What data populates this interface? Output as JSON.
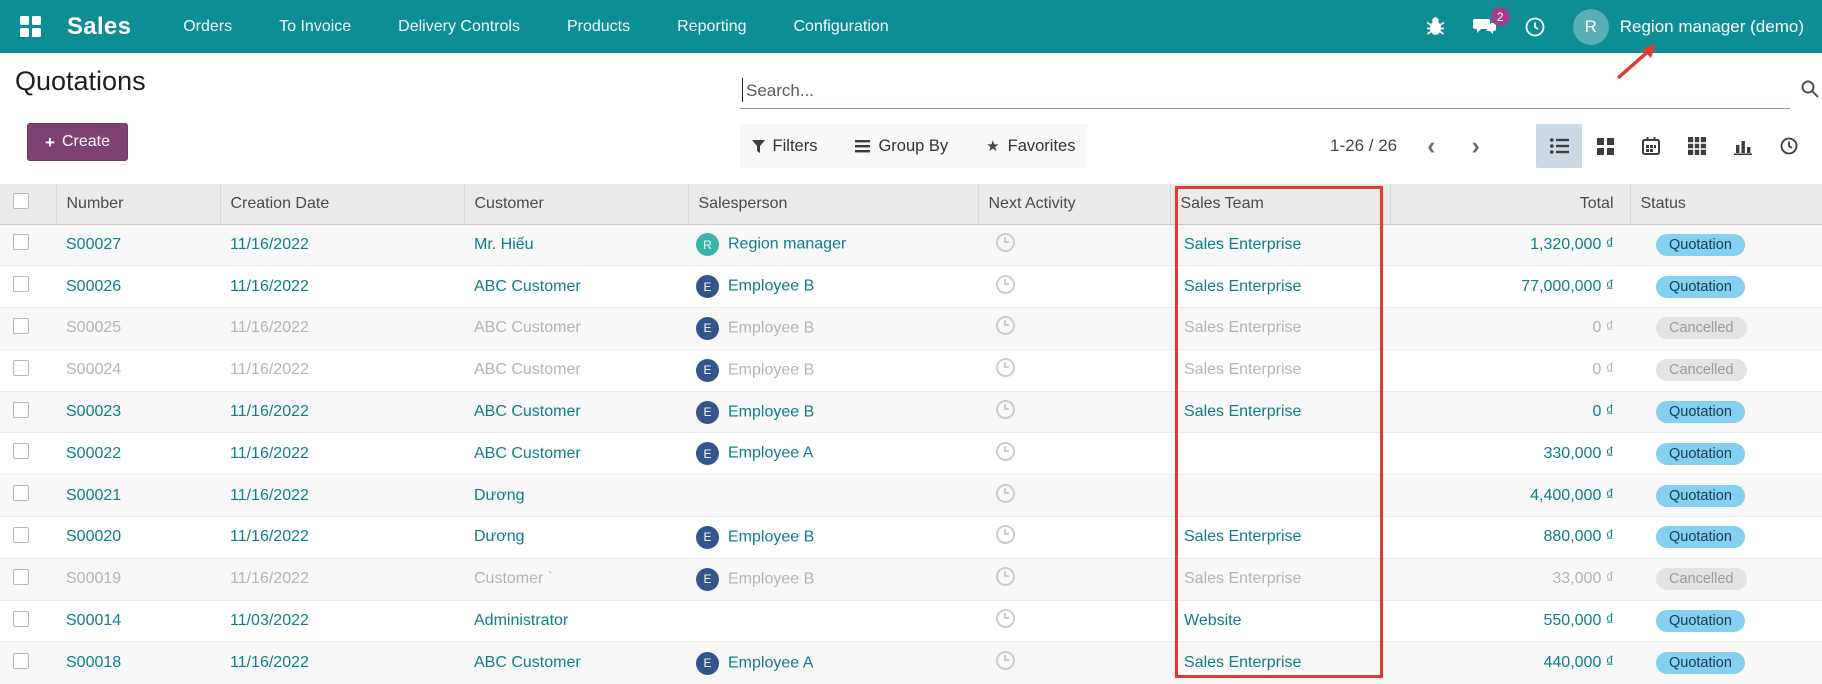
{
  "navbar": {
    "app_name": "Sales",
    "menu": [
      {
        "label": "Orders"
      },
      {
        "label": "To Invoice"
      },
      {
        "label": "Delivery Controls"
      },
      {
        "label": "Products"
      },
      {
        "label": "Reporting"
      },
      {
        "label": "Configuration"
      }
    ],
    "message_count": "2",
    "user": {
      "initial": "R",
      "name": "Region manager (demo)"
    },
    "icons": [
      "apps-grid-icon",
      "bug-icon",
      "messages-icon",
      "activity-clock-icon",
      "user-avatar"
    ]
  },
  "page": {
    "title": "Quotations",
    "create_label": "Create",
    "create_plus_glyph": "+"
  },
  "search": {
    "placeholder": "Search...",
    "filters_label": "Filters",
    "group_by_label": "Group By",
    "favorites_label": "Favorites",
    "favorites_star_glyph": "★"
  },
  "pager": {
    "range": "1-26 / 26",
    "prev_glyph": "‹",
    "next_glyph": "›"
  },
  "view_switcher": {
    "views": [
      "list-view",
      "kanban-view",
      "calendar-view",
      "pivot-view",
      "graph-view",
      "activity-view"
    ],
    "active": "list-view"
  },
  "table": {
    "columns": {
      "number": "Number",
      "creation_date": "Creation Date",
      "customer": "Customer",
      "salesperson": "Salesperson",
      "next_activity": "Next Activity",
      "sales_team": "Sales Team",
      "total": "Total",
      "status": "Status"
    },
    "rows": [
      {
        "number": "S00027",
        "date": "11/16/2022",
        "customer": "Mr. Hiếu",
        "salesperson_initial": "R",
        "salesperson": "Region manager",
        "avatar_color": "#36b5a8",
        "team": "Sales Enterprise",
        "total": "1,320,000 ₫",
        "status": "Quotation"
      },
      {
        "number": "S00026",
        "date": "11/16/2022",
        "customer": "ABC Customer",
        "salesperson_initial": "E",
        "salesperson": "Employee B",
        "avatar_color": "#34558b",
        "team": "Sales Enterprise",
        "total": "77,000,000 ₫",
        "status": "Quotation"
      },
      {
        "number": "S00025",
        "date": "11/16/2022",
        "customer": "ABC Customer",
        "salesperson_initial": "E",
        "salesperson": "Employee B",
        "avatar_color": "#34558b",
        "team": "Sales Enterprise",
        "total": "0 ₫",
        "status": "Cancelled"
      },
      {
        "number": "S00024",
        "date": "11/16/2022",
        "customer": "ABC Customer",
        "salesperson_initial": "E",
        "salesperson": "Employee B",
        "avatar_color": "#34558b",
        "team": "Sales Enterprise",
        "total": "0 ₫",
        "status": "Cancelled"
      },
      {
        "number": "S00023",
        "date": "11/16/2022",
        "customer": "ABC Customer",
        "salesperson_initial": "E",
        "salesperson": "Employee B",
        "avatar_color": "#34558b",
        "team": "Sales Enterprise",
        "total": "0 ₫",
        "status": "Quotation"
      },
      {
        "number": "S00022",
        "date": "11/16/2022",
        "customer": "ABC Customer",
        "salesperson_initial": "E",
        "salesperson": "Employee A",
        "avatar_color": "#34558b",
        "team": "",
        "total": "330,000 ₫",
        "status": "Quotation"
      },
      {
        "number": "S00021",
        "date": "11/16/2022",
        "customer": "Dương",
        "salesperson_initial": "",
        "salesperson": "",
        "avatar_color": "",
        "team": "",
        "total": "4,400,000 ₫",
        "status": "Quotation"
      },
      {
        "number": "S00020",
        "date": "11/16/2022",
        "customer": "Dương",
        "salesperson_initial": "E",
        "salesperson": "Employee B",
        "avatar_color": "#34558b",
        "team": "Sales Enterprise",
        "total": "880,000 ₫",
        "status": "Quotation"
      },
      {
        "number": "S00019",
        "date": "11/16/2022",
        "customer": "Customer `",
        "salesperson_initial": "E",
        "salesperson": "Employee B",
        "avatar_color": "#34558b",
        "team": "Sales Enterprise",
        "total": "33,000 ₫",
        "status": "Cancelled"
      },
      {
        "number": "S00014",
        "date": "11/03/2022",
        "customer": "Administrator",
        "salesperson_initial": "",
        "salesperson": "",
        "avatar_color": "",
        "team": "Website",
        "total": "550,000 ₫",
        "status": "Quotation"
      },
      {
        "number": "S00018",
        "date": "11/16/2022",
        "customer": "ABC Customer",
        "salesperson_initial": "E",
        "salesperson": "Employee A",
        "avatar_color": "#34558b",
        "team": "Sales Enterprise",
        "total": "440,000 ₫",
        "status": "Quotation"
      }
    ]
  },
  "annotations": {
    "highlighted_column": "Sales Team",
    "arrow_target": "Region manager (demo)",
    "color": "#e13a30"
  },
  "colors": {
    "navbar_bg": "#0d8e95",
    "create_button_bg": "#7d4271",
    "link_teal": "#0d7e85",
    "quotation_pill_bg": "#85cff1",
    "cancelled_pill_bg": "#e3e3e5",
    "message_badge_bg": "#a03e8c",
    "annotation_red": "#e13a30"
  }
}
